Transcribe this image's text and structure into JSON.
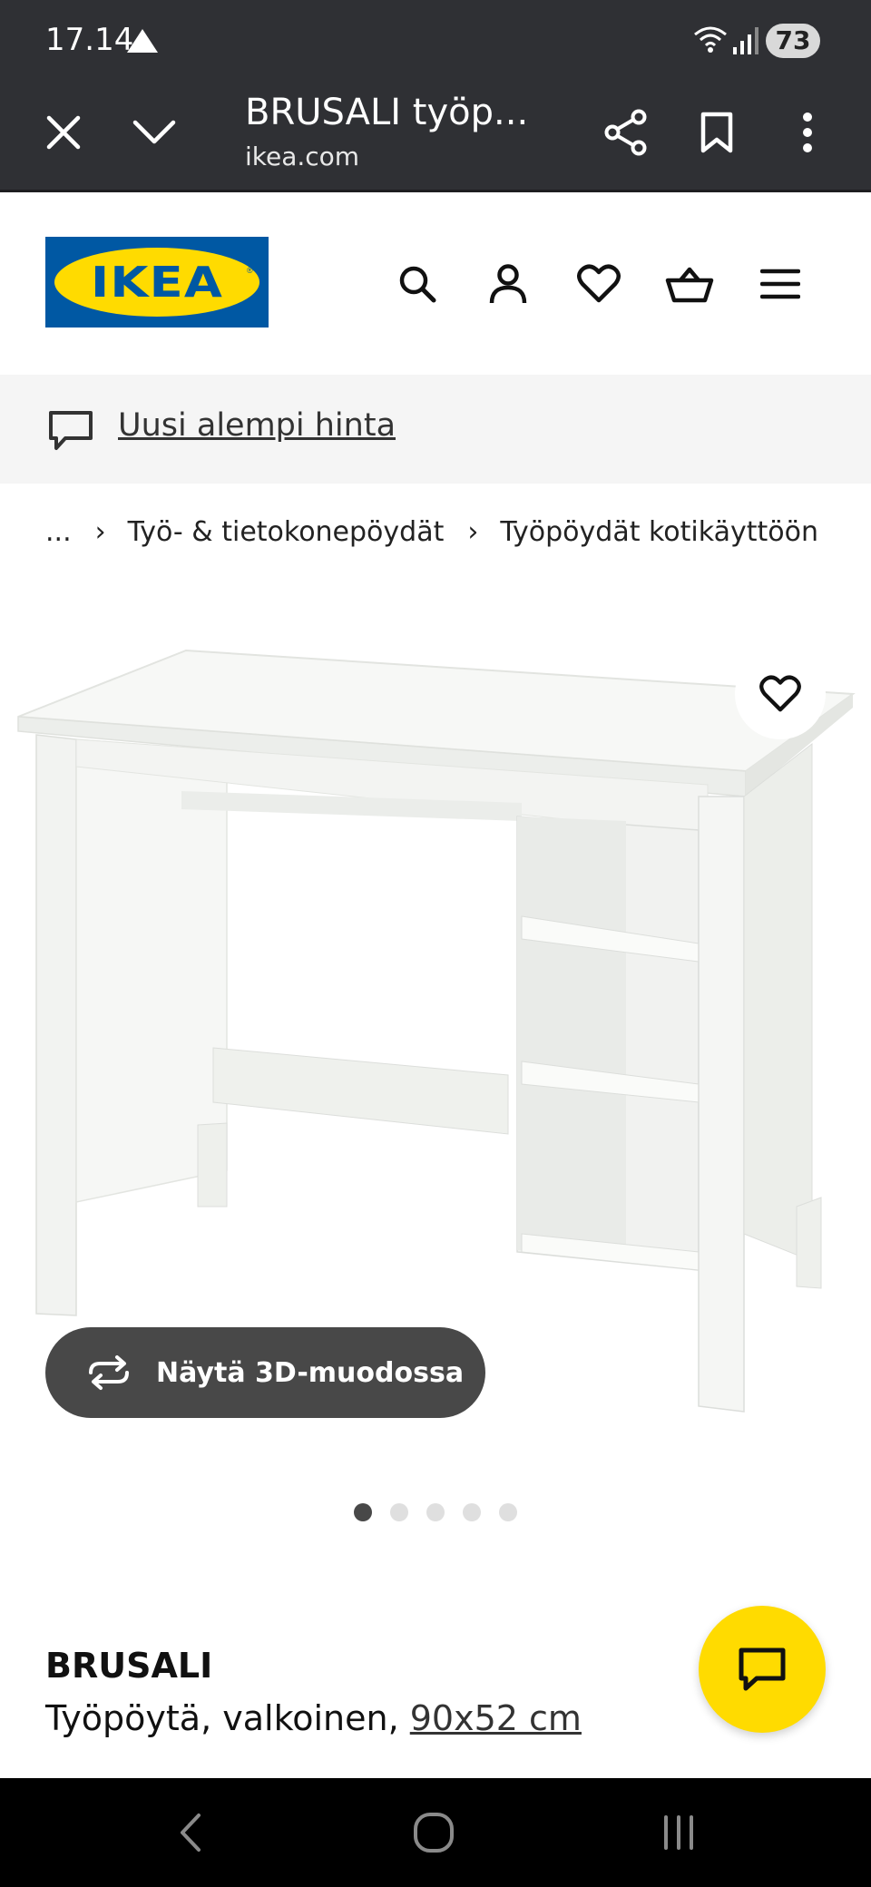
{
  "status_bar": {
    "time": "17.14",
    "battery": "73"
  },
  "browser": {
    "page_title": "BRUSALI työp...",
    "domain": "ikea.com"
  },
  "header": {
    "logo_text": "IKEA"
  },
  "promo": {
    "link_text": "Uusi alempi hinta"
  },
  "breadcrumb": {
    "items": [
      "...",
      "Työ- & tietokonepöydät",
      "Työpöydät kotikäyttöön"
    ],
    "separator": "›"
  },
  "gallery": {
    "view_3d_label": "Näytä 3D-muodossa",
    "dots_total": 5,
    "active_index": 0
  },
  "product": {
    "name": "BRUSALI",
    "description": "Työpöytä, valkoinen,",
    "dimensions": "90x52 cm"
  },
  "colors": {
    "ikea_blue": "#0058a3",
    "ikea_yellow": "#ffdb00",
    "browser_bar": "#2f3034",
    "button_dark": "#484848"
  }
}
